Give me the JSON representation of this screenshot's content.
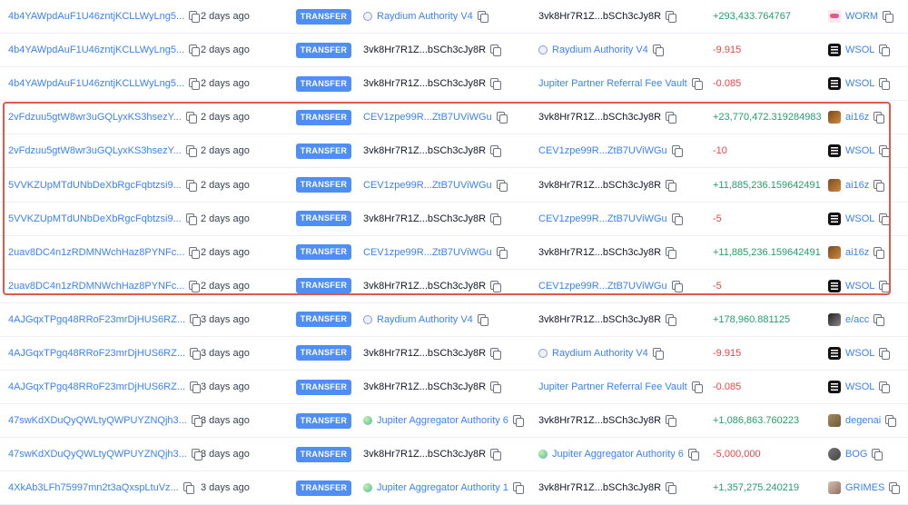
{
  "rows": [
    {
      "sig": "4b4YAWpdAuF1U46zntjKCLLWyLng5...",
      "time": "2 days ago",
      "action": "TRANSFER",
      "from": {
        "text": "Raydium Authority V4",
        "type": "link",
        "icon": "ray"
      },
      "to": {
        "text": "3vk8Hr7R1Z...bSCh3cJy8R",
        "type": "addr",
        "icon": ""
      },
      "amount": "+293,433.764767",
      "sign": "pos",
      "token": "WORM",
      "tokicon": "worm"
    },
    {
      "sig": "4b4YAWpdAuF1U46zntjKCLLWyLng5...",
      "time": "2 days ago",
      "action": "TRANSFER",
      "from": {
        "text": "3vk8Hr7R1Z...bSCh3cJy8R",
        "type": "addr",
        "icon": ""
      },
      "to": {
        "text": "Raydium Authority V4",
        "type": "link",
        "icon": "ray"
      },
      "amount": "-9.915",
      "sign": "neg",
      "token": "WSOL",
      "tokicon": "wsol"
    },
    {
      "sig": "4b4YAWpdAuF1U46zntjKCLLWyLng5...",
      "time": "2 days ago",
      "action": "TRANSFER",
      "from": {
        "text": "3vk8Hr7R1Z...bSCh3cJy8R",
        "type": "addr",
        "icon": ""
      },
      "to": {
        "text": "Jupiter Partner Referral Fee Vault",
        "type": "link",
        "icon": ""
      },
      "amount": "-0.085",
      "sign": "neg",
      "token": "WSOL",
      "tokicon": "wsol"
    },
    {
      "sig": "2vFdzuu5gtW8wr3uGQLyxKS3hsezY...",
      "time": "2 days ago",
      "action": "TRANSFER",
      "from": {
        "text": "CEV1zpe99R...ZtB7UViWGu",
        "type": "link",
        "icon": ""
      },
      "to": {
        "text": "3vk8Hr7R1Z...bSCh3cJy8R",
        "type": "addr",
        "icon": ""
      },
      "amount": "+23,770,472.319284983",
      "sign": "pos",
      "token": "ai16z",
      "tokicon": "ai16z"
    },
    {
      "sig": "2vFdzuu5gtW8wr3uGQLyxKS3hsezY...",
      "time": "2 days ago",
      "action": "TRANSFER",
      "from": {
        "text": "3vk8Hr7R1Z...bSCh3cJy8R",
        "type": "addr",
        "icon": ""
      },
      "to": {
        "text": "CEV1zpe99R...ZtB7UViWGu",
        "type": "link",
        "icon": ""
      },
      "amount": "-10",
      "sign": "neg",
      "token": "WSOL",
      "tokicon": "wsol"
    },
    {
      "sig": "5VVKZUpMTdUNbDeXbRgcFqbtzsi9...",
      "time": "2 days ago",
      "action": "TRANSFER",
      "from": {
        "text": "CEV1zpe99R...ZtB7UViWGu",
        "type": "link",
        "icon": ""
      },
      "to": {
        "text": "3vk8Hr7R1Z...bSCh3cJy8R",
        "type": "addr",
        "icon": ""
      },
      "amount": "+11,885,236.159642491",
      "sign": "pos",
      "token": "ai16z",
      "tokicon": "ai16z"
    },
    {
      "sig": "5VVKZUpMTdUNbDeXbRgcFqbtzsi9...",
      "time": "2 days ago",
      "action": "TRANSFER",
      "from": {
        "text": "3vk8Hr7R1Z...bSCh3cJy8R",
        "type": "addr",
        "icon": ""
      },
      "to": {
        "text": "CEV1zpe99R...ZtB7UViWGu",
        "type": "link",
        "icon": ""
      },
      "amount": "-5",
      "sign": "neg",
      "token": "WSOL",
      "tokicon": "wsol"
    },
    {
      "sig": "2uav8DC4n1zRDMNWchHaz8PYNFc...",
      "time": "2 days ago",
      "action": "TRANSFER",
      "from": {
        "text": "CEV1zpe99R...ZtB7UViWGu",
        "type": "link",
        "icon": ""
      },
      "to": {
        "text": "3vk8Hr7R1Z...bSCh3cJy8R",
        "type": "addr",
        "icon": ""
      },
      "amount": "+11,885,236.159642491",
      "sign": "pos",
      "token": "ai16z",
      "tokicon": "ai16z"
    },
    {
      "sig": "2uav8DC4n1zRDMNWchHaz8PYNFc...",
      "time": "2 days ago",
      "action": "TRANSFER",
      "from": {
        "text": "3vk8Hr7R1Z...bSCh3cJy8R",
        "type": "addr",
        "icon": ""
      },
      "to": {
        "text": "CEV1zpe99R...ZtB7UViWGu",
        "type": "link",
        "icon": ""
      },
      "amount": "-5",
      "sign": "neg",
      "token": "WSOL",
      "tokicon": "wsol"
    },
    {
      "sig": "4AJGqxTPgq48RRoF23mrDjHUS6RZ...",
      "time": "3 days ago",
      "action": "TRANSFER",
      "from": {
        "text": "Raydium Authority V4",
        "type": "link",
        "icon": "ray"
      },
      "to": {
        "text": "3vk8Hr7R1Z...bSCh3cJy8R",
        "type": "addr",
        "icon": ""
      },
      "amount": "+178,960.881125",
      "sign": "pos",
      "token": "e/acc",
      "tokicon": "eacc"
    },
    {
      "sig": "4AJGqxTPgq48RRoF23mrDjHUS6RZ...",
      "time": "3 days ago",
      "action": "TRANSFER",
      "from": {
        "text": "3vk8Hr7R1Z...bSCh3cJy8R",
        "type": "addr",
        "icon": ""
      },
      "to": {
        "text": "Raydium Authority V4",
        "type": "link",
        "icon": "ray"
      },
      "amount": "-9.915",
      "sign": "neg",
      "token": "WSOL",
      "tokicon": "wsol"
    },
    {
      "sig": "4AJGqxTPgq48RRoF23mrDjHUS6RZ...",
      "time": "3 days ago",
      "action": "TRANSFER",
      "from": {
        "text": "3vk8Hr7R1Z...bSCh3cJy8R",
        "type": "addr",
        "icon": ""
      },
      "to": {
        "text": "Jupiter Partner Referral Fee Vault",
        "type": "link",
        "icon": ""
      },
      "amount": "-0.085",
      "sign": "neg",
      "token": "WSOL",
      "tokicon": "wsol"
    },
    {
      "sig": "47swKdXDuQyQWLtyQWPUYZNQjh3...",
      "time": "3 days ago",
      "action": "TRANSFER",
      "from": {
        "text": "Jupiter Aggregator Authority 6",
        "type": "link",
        "icon": "jup"
      },
      "to": {
        "text": "3vk8Hr7R1Z...bSCh3cJy8R",
        "type": "addr",
        "icon": ""
      },
      "amount": "+1,086,863.760223",
      "sign": "pos",
      "token": "degenai",
      "tokicon": "degen"
    },
    {
      "sig": "47swKdXDuQyQWLtyQWPUYZNQjh3...",
      "time": "3 days ago",
      "action": "TRANSFER",
      "from": {
        "text": "3vk8Hr7R1Z...bSCh3cJy8R",
        "type": "addr",
        "icon": ""
      },
      "to": {
        "text": "Jupiter Aggregator Authority 6",
        "type": "link",
        "icon": "jup"
      },
      "amount": "-5,000,000",
      "sign": "neg",
      "token": "BOG",
      "tokicon": "bog"
    },
    {
      "sig": "4XkAb3LFh75997mn2t3aQxspLtuVz...",
      "time": "3 days ago",
      "action": "TRANSFER",
      "from": {
        "text": "Jupiter Aggregator Authority 1",
        "type": "link",
        "icon": "jup"
      },
      "to": {
        "text": "3vk8Hr7R1Z...bSCh3cJy8R",
        "type": "addr",
        "icon": ""
      },
      "amount": "+1,357,275.240219",
      "sign": "pos",
      "token": "GRIMES",
      "tokicon": "grimes"
    }
  ],
  "colors": {
    "link": "#3b82f6",
    "positive": "#22a06b",
    "negative": "#ef4444",
    "badge": "#4f8ef7",
    "highlight": "#e05a4b"
  }
}
